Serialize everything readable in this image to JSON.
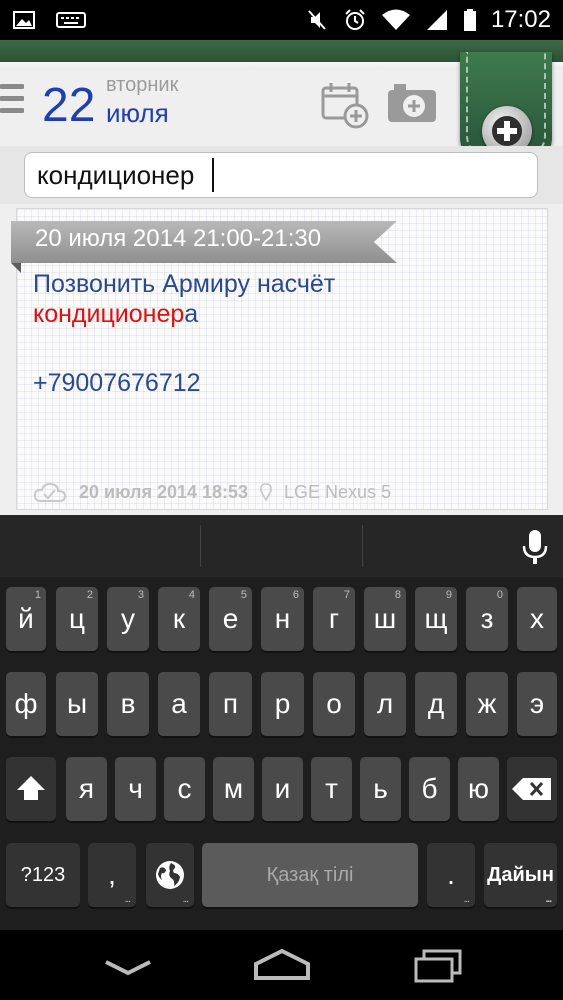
{
  "status_bar": {
    "time": "17:02",
    "icons": [
      "image-icon",
      "keyboard-icon",
      "mute-icon",
      "alarm-icon",
      "wifi-icon",
      "signal-icon",
      "battery-icon"
    ]
  },
  "header": {
    "day": "22",
    "weekday": "вторник",
    "month": "июля"
  },
  "search": {
    "value": "кондиционер"
  },
  "note": {
    "date_range": "20 июля 2014 21:00-21:30",
    "text_line1": "Позвонить Армиру насчёт",
    "highlight": "кондиционер",
    "highlight_rest": "а",
    "phone": "+79007676712",
    "saved_at": "20 июля 2014 18:53",
    "device": "LGE Nexus 5"
  },
  "keyboard": {
    "row1": [
      {
        "label": "й",
        "hint": "1"
      },
      {
        "label": "ц",
        "hint": "2"
      },
      {
        "label": "у",
        "hint": "3"
      },
      {
        "label": "к",
        "hint": "4"
      },
      {
        "label": "е",
        "hint": "5"
      },
      {
        "label": "н",
        "hint": "6"
      },
      {
        "label": "г",
        "hint": "7"
      },
      {
        "label": "ш",
        "hint": "8"
      },
      {
        "label": "щ",
        "hint": "9"
      },
      {
        "label": "з",
        "hint": "0"
      },
      {
        "label": "х",
        "hint": ""
      }
    ],
    "row2": [
      "ф",
      "ы",
      "в",
      "а",
      "п",
      "р",
      "о",
      "л",
      "д",
      "ж",
      "э"
    ],
    "row3": [
      "я",
      "ч",
      "с",
      "м",
      "и",
      "т",
      "ь",
      "б",
      "ю"
    ],
    "symbols_label": "?123",
    "comma": ",",
    "space_label": "Қазақ тілі",
    "period": ".",
    "enter_label": "Дайын"
  },
  "colors": {
    "accent_blue": "#1f3fb0",
    "note_text": "#2b4a8b",
    "highlight": "#e01010",
    "leather_green": "#2f5f3d"
  }
}
